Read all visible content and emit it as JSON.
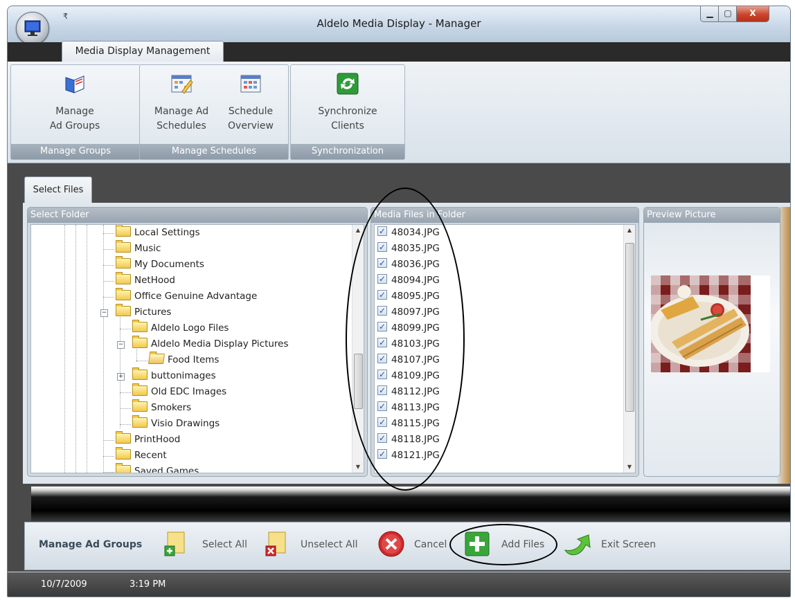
{
  "window": {
    "title": "Aldelo Media Display - Manager",
    "qat_glyph": "₹",
    "controls": {
      "minimize": "▁",
      "maximize": "▢",
      "close": "X"
    }
  },
  "ribbon": {
    "tab": "Media Display Management",
    "groups": [
      {
        "label": "Manage Groups",
        "buttons": [
          {
            "label_line1": "Manage",
            "label_line2": "Ad Groups",
            "icon": "book-icon"
          }
        ]
      },
      {
        "label": "Manage Schedules",
        "buttons": [
          {
            "label_line1": "Manage Ad",
            "label_line2": "Schedules",
            "icon": "calendar-edit-icon"
          },
          {
            "label_line1": "Schedule",
            "label_line2": "Overview",
            "icon": "calendar-grid-icon"
          }
        ]
      },
      {
        "label": "Synchronization",
        "buttons": [
          {
            "label_line1": "Synchronize",
            "label_line2": "Clients",
            "icon": "sync-icon"
          }
        ]
      }
    ]
  },
  "content_tab": "Select Files",
  "folder_panel": {
    "header": "Select Folder",
    "items": [
      {
        "label": "Local Settings"
      },
      {
        "label": "Music"
      },
      {
        "label": "My Documents"
      },
      {
        "label": "NetHood"
      },
      {
        "label": "Office Genuine Advantage"
      },
      {
        "label": "Pictures",
        "expander": "−"
      },
      {
        "label": "Aldelo Logo Files"
      },
      {
        "label": "Aldelo Media Display Pictures",
        "expander": "−"
      },
      {
        "label": "Food Items",
        "open": true
      },
      {
        "label": "buttonimages",
        "expander": "+"
      },
      {
        "label": "Old EDC Images"
      },
      {
        "label": "Smokers"
      },
      {
        "label": "Visio Drawings"
      },
      {
        "label": "PrintHood"
      },
      {
        "label": "Recent"
      },
      {
        "label": "Saved Games"
      }
    ]
  },
  "files_panel": {
    "header": "Media Files in Folder",
    "files": [
      "48034.JPG",
      "48035.JPG",
      "48036.JPG",
      "48094.JPG",
      "48095.JPG",
      "48097.JPG",
      "48099.JPG",
      "48103.JPG",
      "48107.JPG",
      "48109.JPG",
      "48112.JPG",
      "48113.JPG",
      "48115.JPG",
      "48118.JPG",
      "48121.JPG"
    ]
  },
  "preview_panel": {
    "header": "Preview Picture"
  },
  "toolbar": {
    "title": "Manage Ad Groups",
    "select_all": "Select All",
    "unselect_all": "Unselect All",
    "cancel": "Cancel",
    "add_files": "Add Files",
    "exit_screen": "Exit Screen"
  },
  "status": {
    "date": "10/7/2009",
    "time": "3:19 PM"
  },
  "colors": {
    "ribbon_group_label": "#98a4b0",
    "content_dark": "#4a4a4a",
    "check": "#2b56a8",
    "cancel_red": "#d12a2a",
    "add_green": "#3aa63a"
  }
}
